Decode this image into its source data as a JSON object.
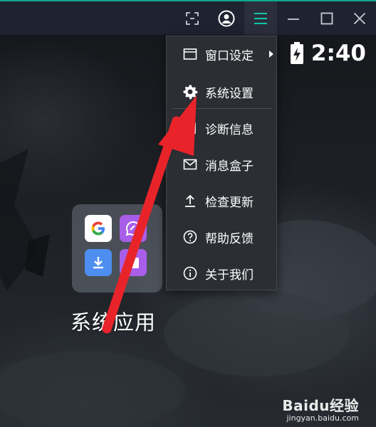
{
  "desktop": {
    "clock": "2:40",
    "folder": {
      "label": "系统应用",
      "apps": [
        "google-icon",
        "messages-icon",
        "download-icon",
        "calendar-icon"
      ]
    }
  },
  "window_controls": [
    "screenshot-icon",
    "account-icon",
    "menu-icon",
    "minimize-icon",
    "maximize-icon",
    "close-icon"
  ],
  "menu": {
    "items": [
      {
        "label": "窗口设定",
        "icon": "window-icon",
        "has_submenu": true
      },
      {
        "label": "系统设置",
        "icon": "gear-icon"
      },
      {
        "label": "诊断信息",
        "icon": "diagnostic-icon"
      },
      {
        "label": "消息盒子",
        "icon": "mail-icon"
      },
      {
        "label": "检查更新",
        "icon": "upload-icon"
      },
      {
        "label": "帮助反馈",
        "icon": "help-icon"
      },
      {
        "label": "关于我们",
        "icon": "info-icon"
      }
    ]
  },
  "watermark": {
    "brand": "Baidu经验",
    "url": "jingyan.baidu.com"
  },
  "colors": {
    "accent": "#0fa88f",
    "arrow": "#e8242a",
    "titlebar": "#1f2230",
    "menu_bg": "#2b2e33"
  }
}
